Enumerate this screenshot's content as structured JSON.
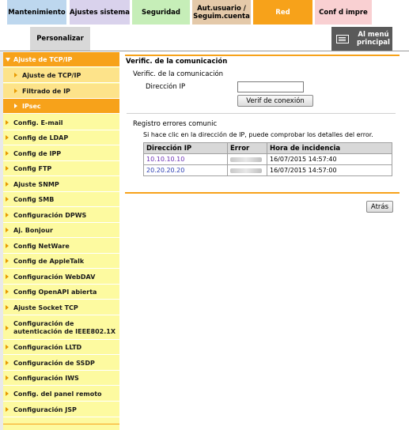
{
  "tabs": {
    "mantenimiento": "Mantenimiento",
    "ajustes_sistema": "Ajustes sistema",
    "seguridad": "Seguridad",
    "aut_line1": "Aut.usuario /",
    "aut_line2": "Seguim.cuenta",
    "red": "Red",
    "conf_impre": "Conf d impre",
    "personalizar": "Personalizar",
    "menu_line1": "Al menú",
    "menu_line2": "principal"
  },
  "sidebar": {
    "top": "Ajuste de TCP/IP",
    "subitems": [
      "Ajuste de TCP/IP",
      "Filtrado de IP",
      "IPsec"
    ],
    "items": [
      "Config. E-mail",
      "Config de LDAP",
      "Config de IPP",
      "Config FTP",
      "Ajuste SNMP",
      "Config SMB",
      "Configuración DPWS",
      "Aj. Bonjour",
      "Config NetWare",
      "Config de AppleTalk",
      "Configuración WebDAV",
      "Config OpenAPI abierta",
      "Ajuste Socket TCP",
      "Configuración de",
      "autenticación de IEEE802.1X",
      "Configuración LLTD",
      "Configuración de SSDP",
      "Configuración IWS",
      "Config. del panel remoto",
      "Configuración JSP"
    ]
  },
  "main": {
    "title": "Verific. de la comunicación",
    "subtitle": "Verific. de la comunicación",
    "ip_label": "Dirección IP",
    "ip_value": "",
    "verify_button": "Verif de conexión",
    "log_title": "Registro errores comunic",
    "log_note": "Si hace clic en la dirección de IP, puede comprobar los detalles del error.",
    "table": {
      "headers": [
        "Dirección IP",
        "Error",
        "Hora de incidencia"
      ],
      "rows": [
        {
          "ip": "10.10.10.10",
          "time": "16/07/2015 14:57:40"
        },
        {
          "ip": "20.20.20.20",
          "time": "16/07/2015 14:57:00"
        }
      ]
    },
    "back_button": "Atrás"
  },
  "colors": {
    "accent": "#f7a21a",
    "sidebar_bg": "#fdfaa0",
    "link_visited": "#6b2fb3",
    "link": "#2c3fb3"
  }
}
